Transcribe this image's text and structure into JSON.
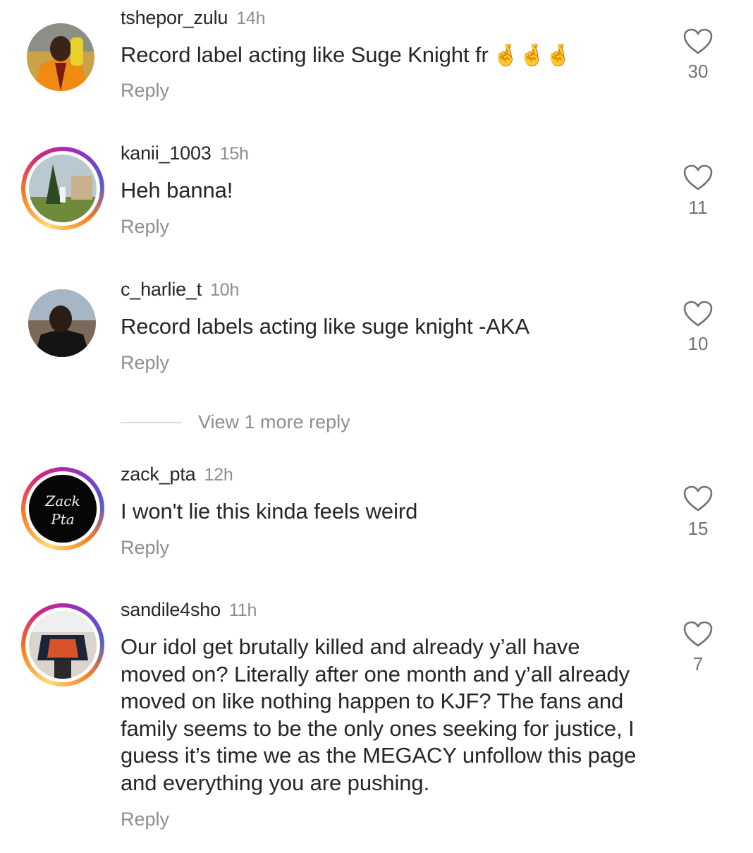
{
  "comments": [
    {
      "username": "tshepor_zulu",
      "time": "14h",
      "text": "Record label acting like Suge Knight fr",
      "emoji": "🤞🤞🤞",
      "reply": "Reply",
      "likes": "30",
      "avatar_icon": "user-avatar-icon"
    },
    {
      "username": "kanii_1003",
      "time": "15h",
      "text": "Heh banna!",
      "reply": "Reply",
      "likes": "11",
      "avatar_icon": "user-avatar-icon"
    },
    {
      "username": "c_harlie_t",
      "time": "10h",
      "text": "Record labels acting like suge knight -AKA",
      "reply": "Reply",
      "likes": "10",
      "avatar_icon": "user-avatar-icon"
    },
    {
      "username": "zack_pta",
      "time": "12h",
      "text": "I won't lie this kinda feels weird",
      "reply": "Reply",
      "likes": "15",
      "avatar_icon": "user-avatar-icon",
      "avatar_text_1": "Zack",
      "avatar_text_2": "Pta"
    },
    {
      "username": "sandile4sho",
      "time": "11h",
      "text": "Our idol get brutally killed and already y’all have moved on? Literally after one month and y’all already moved on like nothing happen to KJF? The fans and family seems to be the only ones seeking for justice, I guess it’s time we as the MEGACY unfollow this page and everything you are pushing.",
      "reply": "Reply",
      "likes": "7",
      "avatar_icon": "user-avatar-icon"
    }
  ],
  "view_more": "View 1 more reply",
  "colors": {
    "text": "#262626",
    "secondary": "#8e8e8e",
    "divider": "#dbdbdb"
  },
  "icons": {
    "like": "heart-outline-icon"
  }
}
